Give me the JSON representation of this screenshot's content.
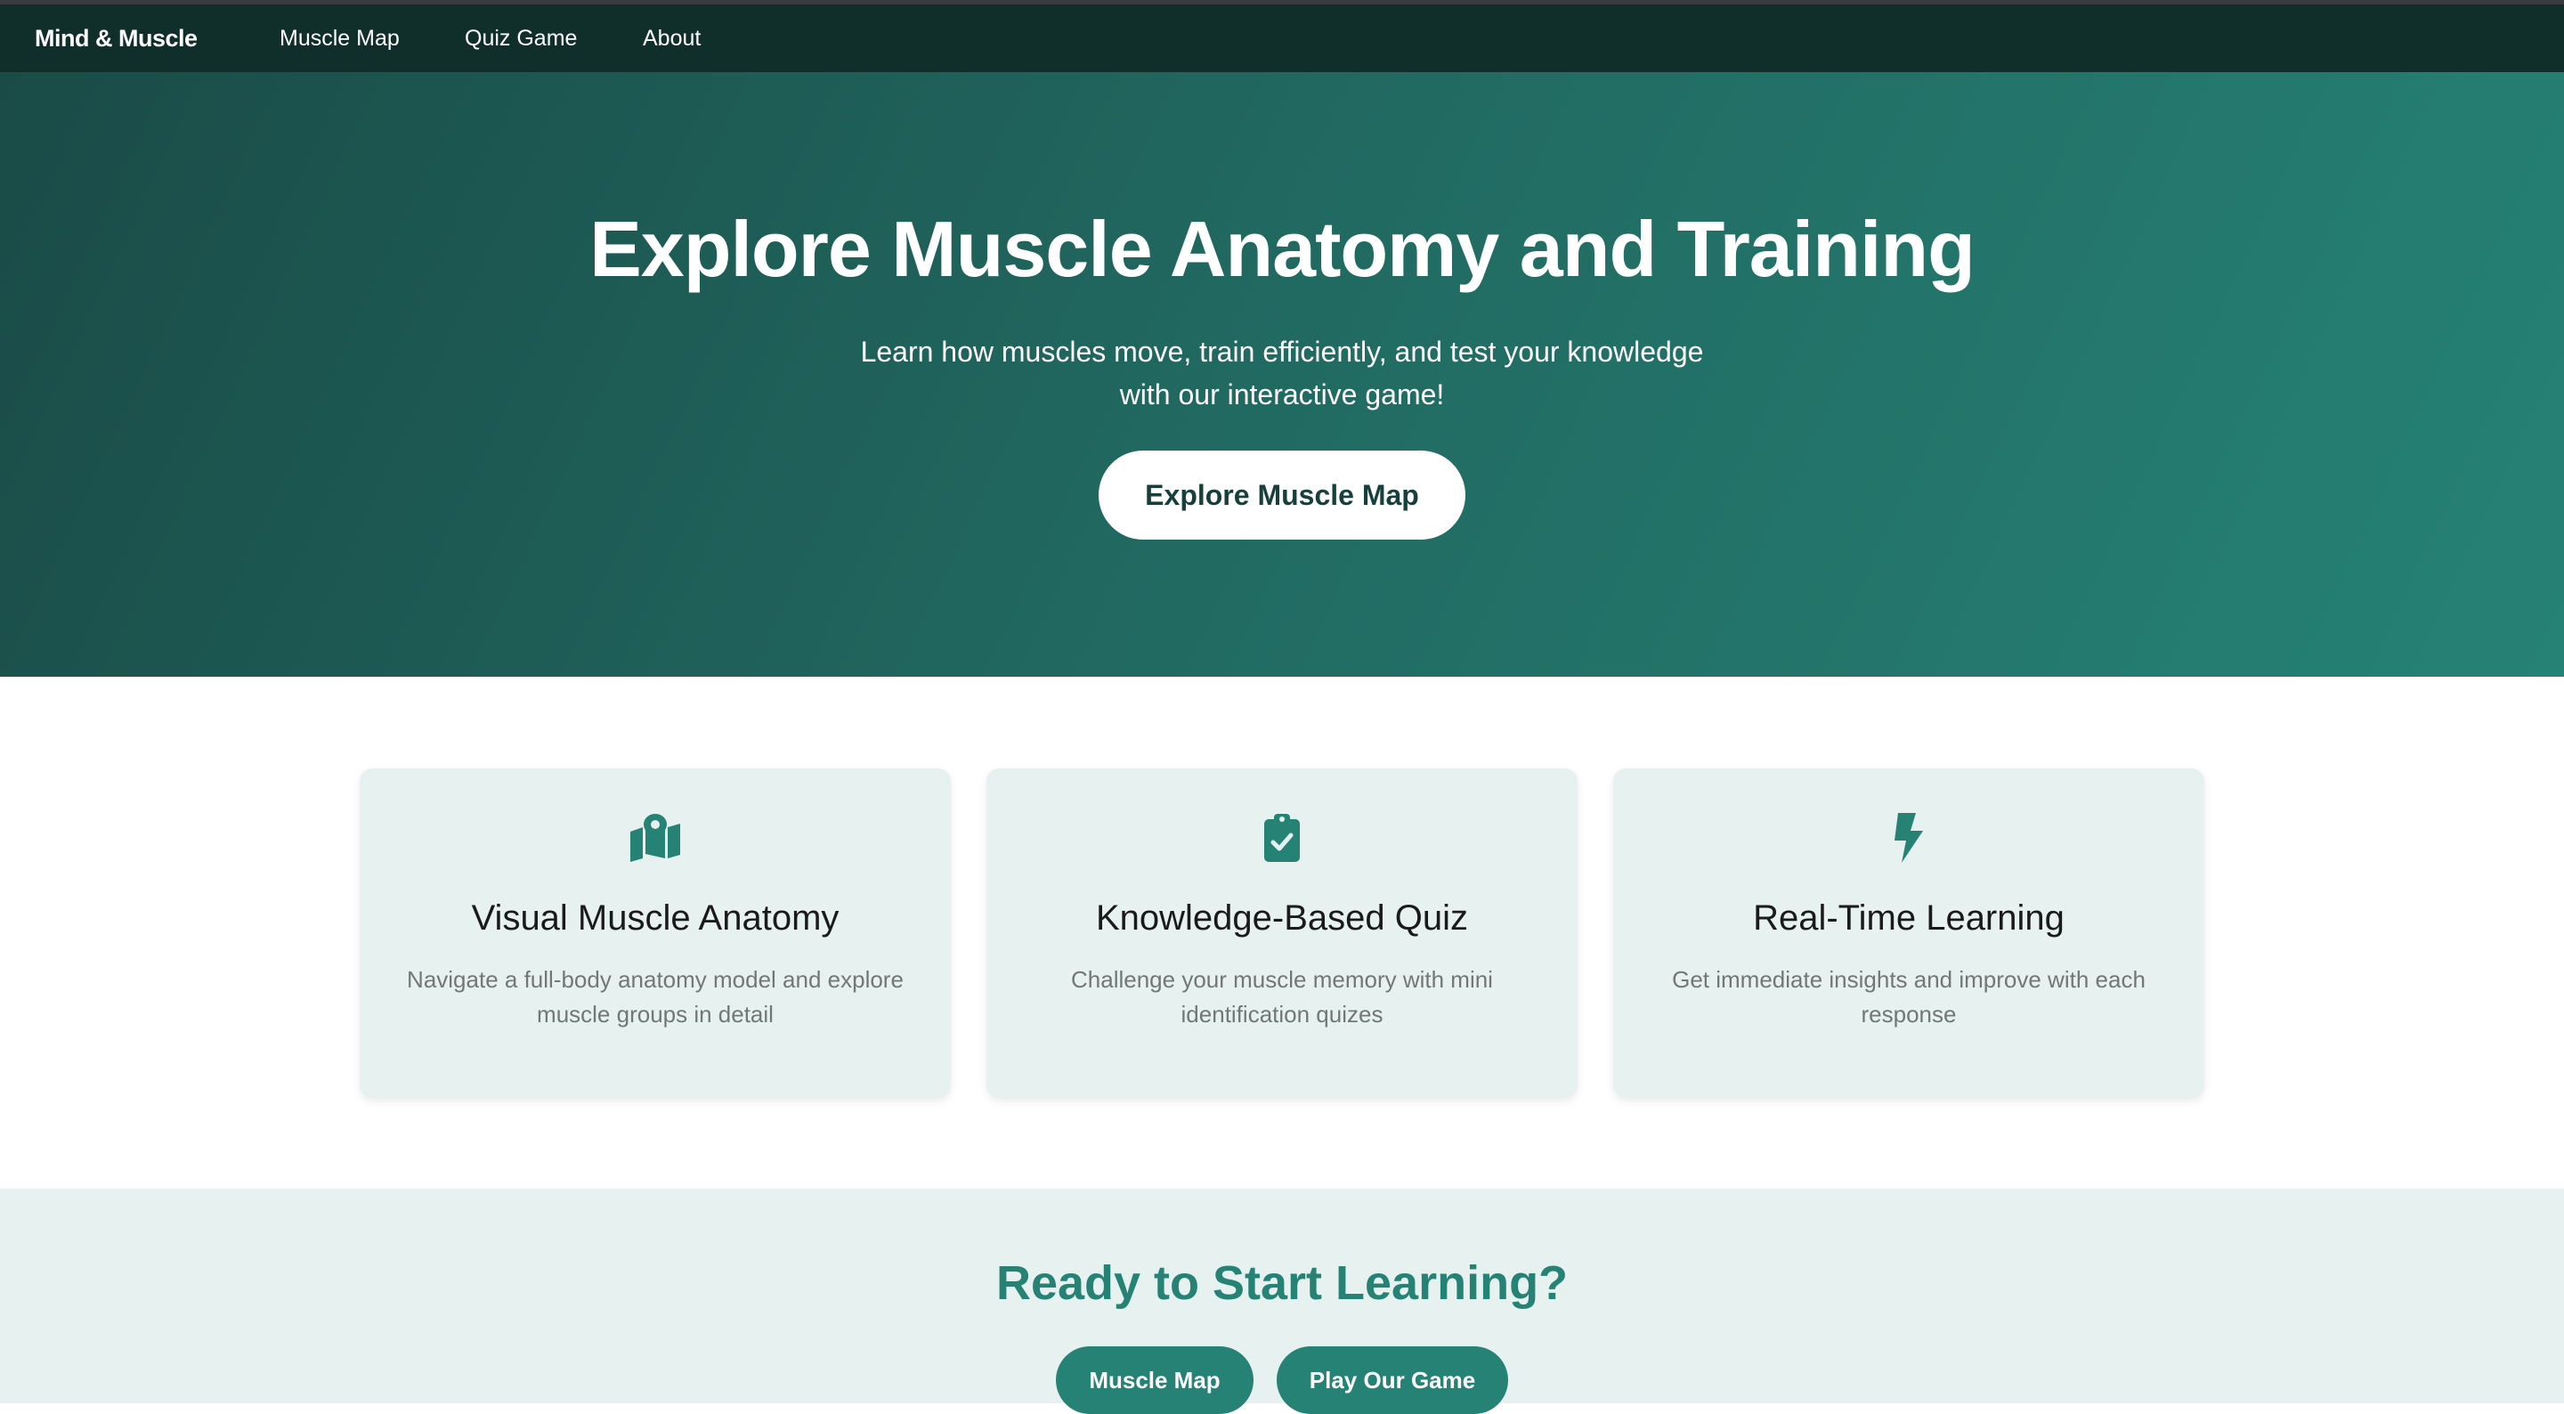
{
  "nav": {
    "brand": "Mind & Muscle",
    "links": [
      "Muscle Map",
      "Quiz Game",
      "About"
    ]
  },
  "hero": {
    "title": "Explore Muscle Anatomy and Training",
    "subtitle": "Learn how muscles move, train efficiently, and test your knowledge with our interactive game!",
    "button_label": "Explore Muscle Map"
  },
  "features": [
    {
      "icon": "map-location-icon",
      "title": "Visual Muscle Anatomy",
      "description": "Navigate a full-body anatomy model and explore muscle groups in detail"
    },
    {
      "icon": "clipboard-check-icon",
      "title": "Knowledge-Based Quiz",
      "description": "Challenge your muscle memory with mini identification quizes"
    },
    {
      "icon": "lightning-bolt-icon",
      "title": "Real-Time Learning",
      "description": "Get immediate insights and improve with each response"
    }
  ],
  "cta": {
    "title": "Ready to Start Learning?",
    "buttons": [
      "Muscle Map",
      "Play Our Game"
    ]
  },
  "colors": {
    "nav_bg": "#102e2a",
    "accent": "#268275",
    "card_bg": "#e7f2f0",
    "hero_gradient_start": "#1a4b47",
    "hero_gradient_end": "#268275"
  }
}
